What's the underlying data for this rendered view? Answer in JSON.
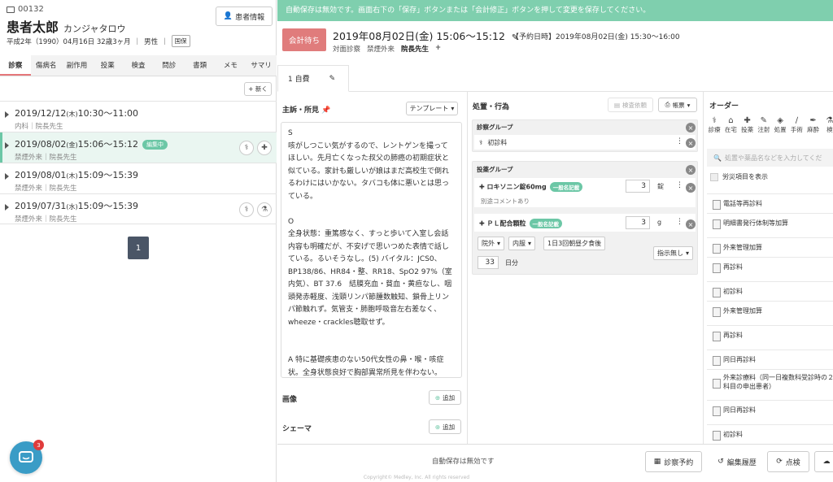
{
  "patient": {
    "id": "00132",
    "name": "患者太郎",
    "kana": "カンジャタロウ",
    "birth": "平成2年（1990）04月16日 32歳3ヶ月",
    "gender": "男性",
    "insurance": "国保",
    "info_button": "患者情報"
  },
  "left_tabs": [
    "診察",
    "傷病名",
    "副作用",
    "投薬",
    "検査",
    "問診",
    "書類",
    "メモ",
    "サマリ"
  ],
  "new_button": "+ 新く",
  "visits": [
    {
      "date": "2019/12/12",
      "dow": "(木)",
      "time": "10:30〜11:00",
      "dept": "内科｜院長先生",
      "badge": ""
    },
    {
      "date": "2019/08/02",
      "dow": "(金)",
      "time": "15:06〜15:12",
      "dept": "禁煙外来｜院長先生",
      "badge": "編集中"
    },
    {
      "date": "2019/08/01",
      "dow": "(木)",
      "time": "15:09〜15:39",
      "dept": "禁煙外来｜院長先生",
      "badge": ""
    },
    {
      "date": "2019/07/31",
      "dow": "(水)",
      "time": "15:09〜15:39",
      "dept": "禁煙外来｜院長先生",
      "badge": ""
    }
  ],
  "pager": "1",
  "chat_badge": "3",
  "banner": "自動保存は無効です。画面右下の「保存」ボタンまたは「会計修正」ボタンを押して変更を保存してください。",
  "status": "会計待ち",
  "encounter": {
    "datetime": "2019年08月02日(金) 15:06〜15:12",
    "reservation": "【予約日時】2019年08月02日(金) 15:30〜16:00",
    "type": "対面診察",
    "dept": "禁煙外来",
    "doctor": "院長先生",
    "plus": "+"
  },
  "encounter_tab": "1 自費",
  "findings": {
    "title": "主訴・所見",
    "template_btn": "テンプレート",
    "text": "S\n咳がしつこい気がするので、レントゲンを撮ってほしい。先月亡くなった叔父の肺癌の初期症状と似ている。家計も厳しいが娘はまだ高校生で倒れるわけにはいかない。タバコも体に悪いとは思っている。\n\nO\n全身状態：重篤感なく、すっと歩いて入室し会話内容も明確だが、不安げで思いつめた表情で話している。るいそうなし。(5) バイタル：JCS0、BP138/86、HR84・整、RR18、SpO2 97%（室内気）、BT 37.6　結膜充血・貧血・黄疸なし、咽頭発赤軽度、浅頸リンパ節腫数触知、鎖骨上リンパ節触れず。気管支・肺胞呼吸音左右差なく、wheeze・crackles聴取せず。\n\n\nA 特に基礎疾患のない50代女性の鼻・喉・咳症状。全身状態良好で胸部異常所見を伴わない。Definite：急性上気道炎→特に矛盾はしない。",
    "image_label": "画像",
    "schema_label": "シェーマ",
    "add": "追加"
  },
  "treatment": {
    "title": "処置・行為",
    "inspection_btn": "検査依頼",
    "print_btn": "帳票",
    "exam_group": "診察グループ",
    "exam_item": "初診料",
    "med_group": "投薬グループ",
    "med1": {
      "name": "ロキソニン錠60mg",
      "tag": "一般名記載",
      "qty": "3",
      "unit": "錠"
    },
    "comment": "別途コメントあり",
    "med2": {
      "name": "ＰＬ配合顆粒",
      "tag": "一般名記載",
      "qty": "3",
      "unit": "g"
    },
    "route": "院外",
    "route2": "内服",
    "dosage": "1日3回朝昼夕食後",
    "days": "33",
    "days_unit": "日分",
    "no_direction": "指示無し"
  },
  "orders": {
    "title": "オーダー",
    "icons": [
      {
        "label": "診療",
        "icon": "stethoscope-icon",
        "glyph": "⚕"
      },
      {
        "label": "在宅",
        "icon": "home-icon",
        "glyph": "⌂"
      },
      {
        "label": "投薬",
        "icon": "pill-icon",
        "glyph": "✚"
      },
      {
        "label": "注射",
        "icon": "syringe-icon",
        "glyph": "✎"
      },
      {
        "label": "処置",
        "icon": "bandage-icon",
        "glyph": "◈"
      },
      {
        "label": "手術",
        "icon": "scalpel-icon",
        "glyph": "∕"
      },
      {
        "label": "麻酔",
        "icon": "anesthesia-icon",
        "glyph": "✒"
      },
      {
        "label": "検",
        "icon": "flask-icon",
        "glyph": "⚗"
      }
    ],
    "search_placeholder": "処置や薬品名などを入力してくだ",
    "disaster": "労災項目を表示",
    "items": [
      "電話等再診料",
      "明細書発行体制等加算",
      "外来管理加算",
      "再診料",
      "初診料",
      "外来管理加算",
      "再診料",
      "同日再診料",
      "外来診療料（同一日複数科受診時の２科目の申出患者）",
      "同日再診料",
      "初診料"
    ]
  },
  "footer": {
    "autosave": "自動保存は無効です",
    "reserve": "診察予約",
    "history": "編集履歴",
    "check": "点検"
  },
  "copyright": "Copyright© Medley, Inc. All rights reserved"
}
